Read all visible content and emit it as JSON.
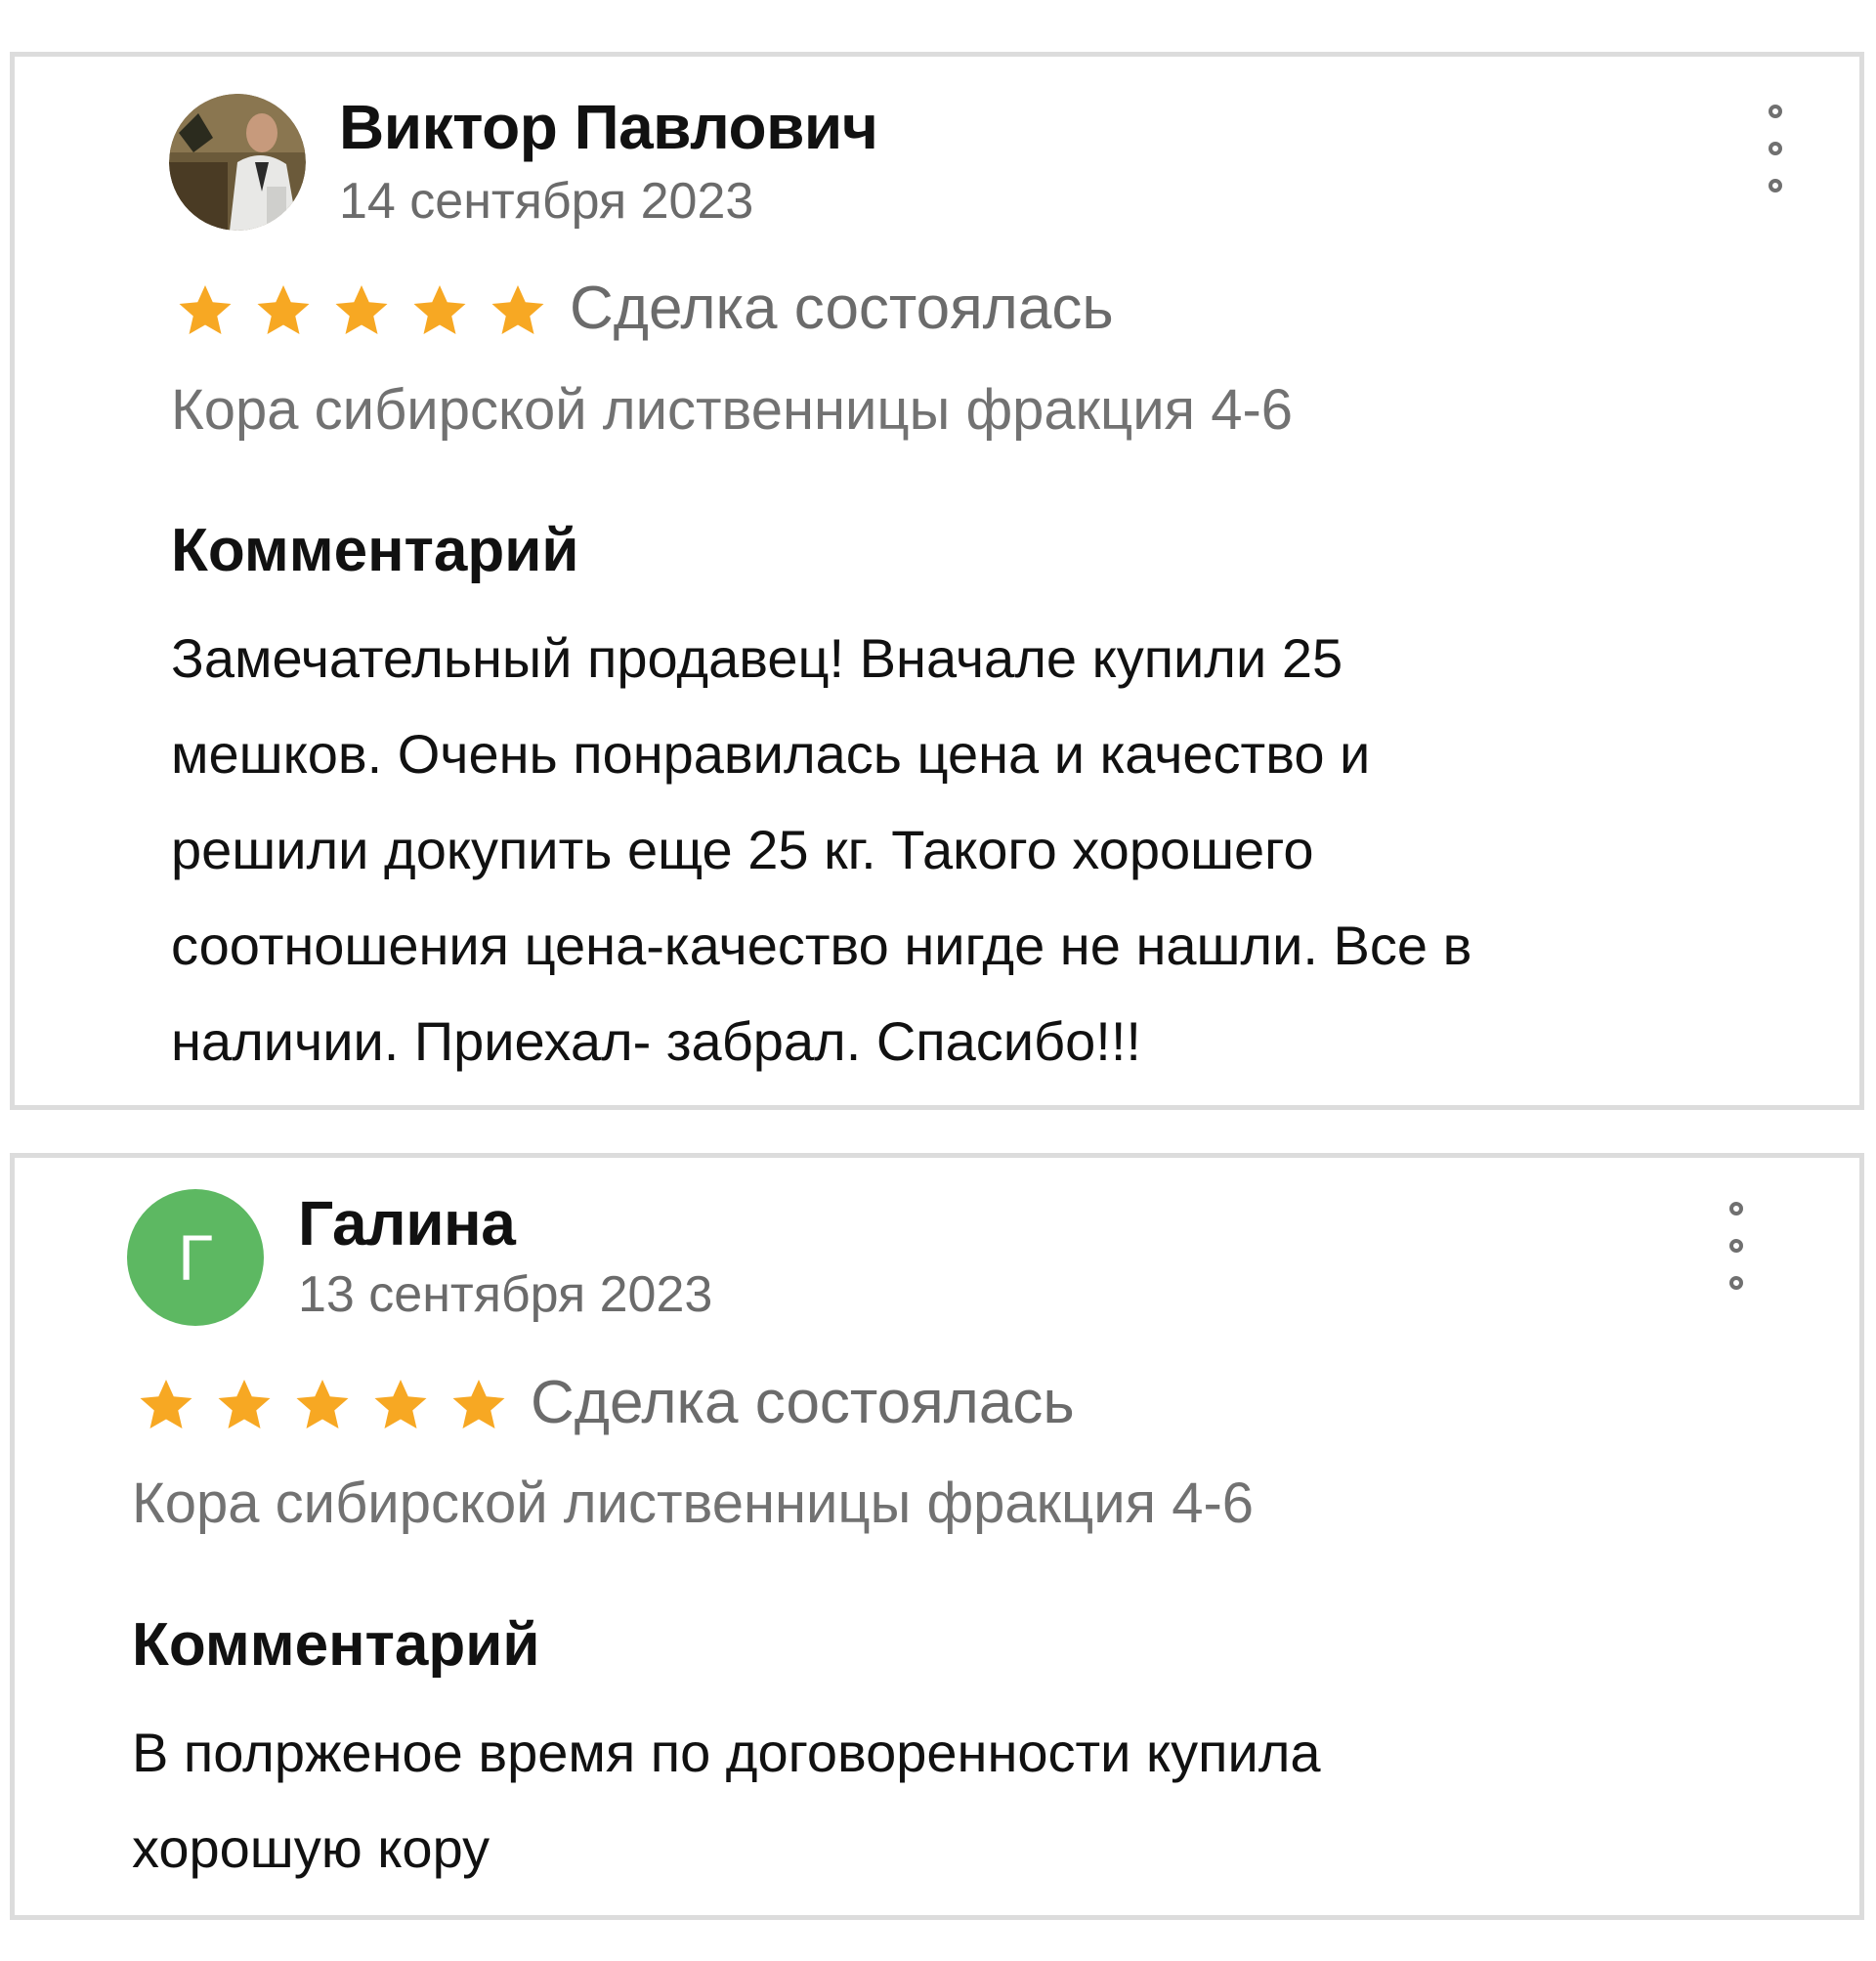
{
  "reviews": [
    {
      "author": "Виктор Павлович",
      "date": "14 сентября 2023",
      "rating": 5,
      "status": "Сделка состоялась",
      "product": "Кора сибирской лиственницы фракция 4-6",
      "comment_heading": "Комментарий",
      "comment_lines": [
        "Замечательный продавец! Вначале купили 25",
        "мешков. Очень понравилась цена и качество и",
        "решили докупить еще 25 кг. Такого хорошего",
        "соотношения цена-качество нигде не нашли. Все в",
        "наличии. Приехал- забрал. Спасибо!!!"
      ]
    },
    {
      "author": "Галина",
      "avatar_letter": "Г",
      "date": "13 сентября 2023",
      "rating": 5,
      "status": "Сделка состоялась",
      "product": "Кора сибирской лиственницы фракция 4-6",
      "comment_heading": "Комментарий",
      "comment_lines": [
        "В полрженое время по договоренности купила",
        "хорошую кору"
      ]
    }
  ],
  "colors": {
    "star": "#f7a823",
    "avatar_green": "#5db862",
    "card_border": "#dcdcdc",
    "muted_text": "#6b6b6b"
  },
  "icons": {
    "menu": "kebab-menu-icon",
    "rating": "star-icon"
  }
}
